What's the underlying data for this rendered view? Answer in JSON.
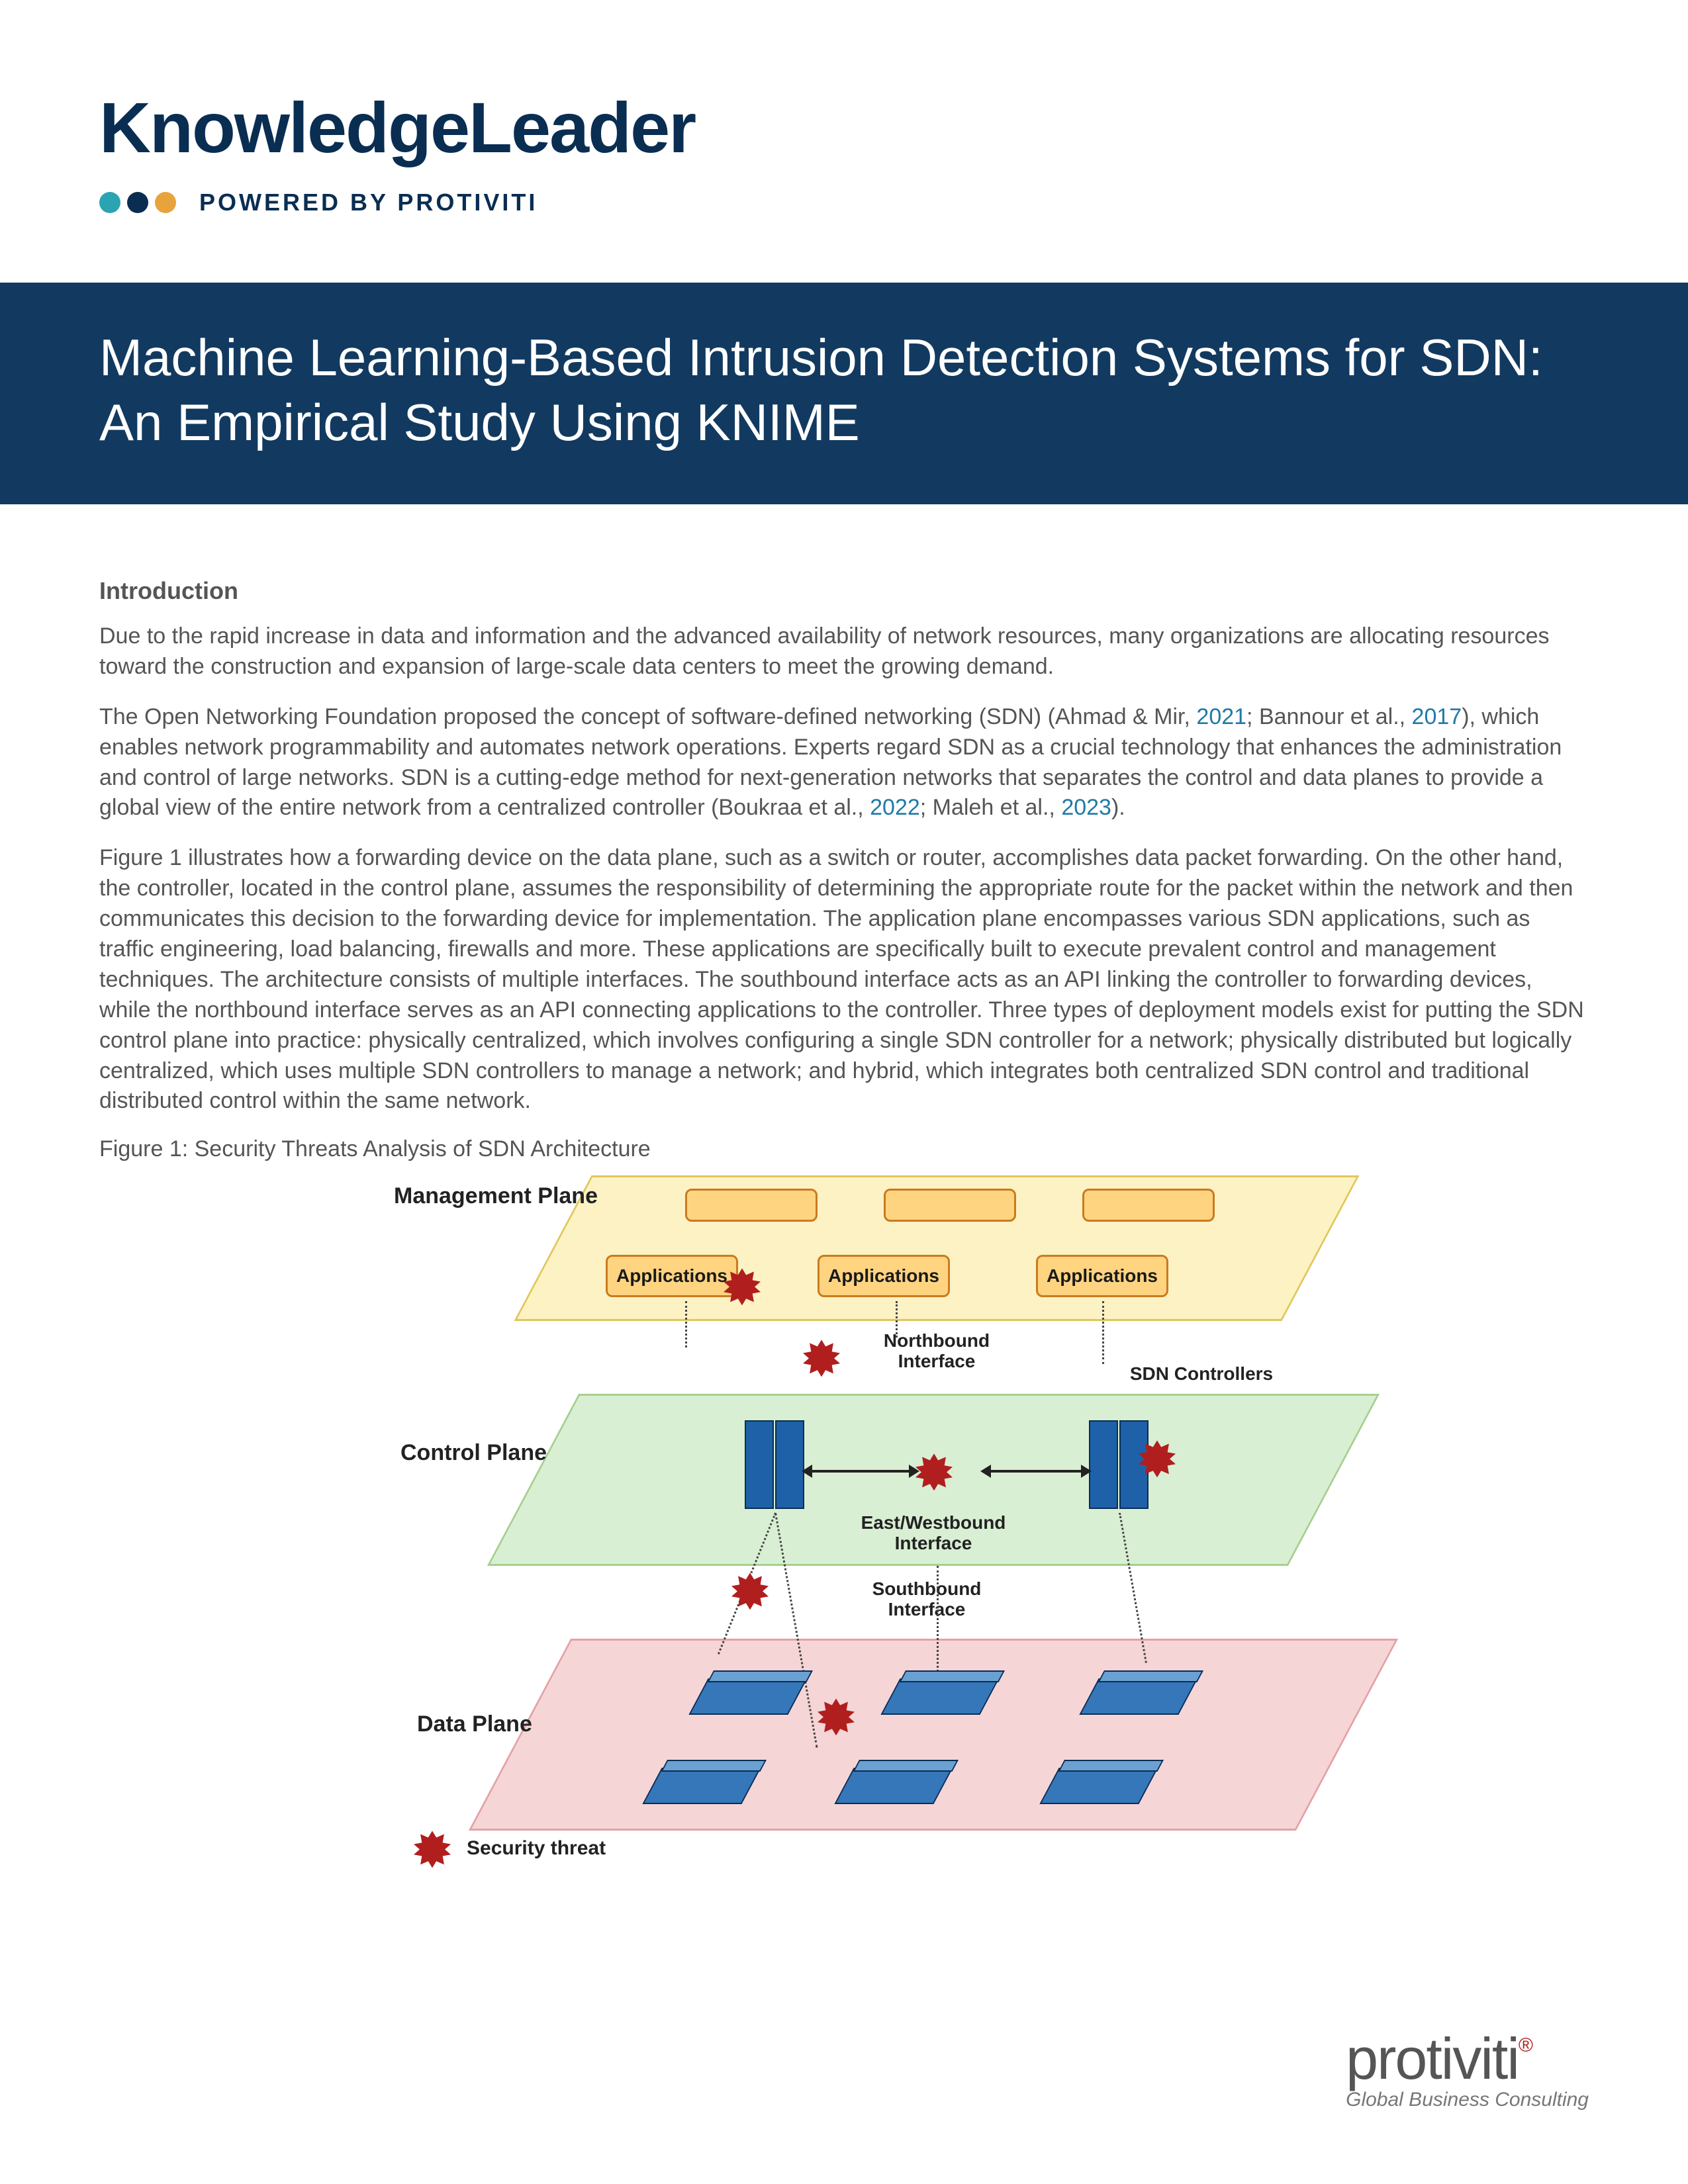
{
  "brand": {
    "name": "KnowledgeLeader",
    "powered": "POWERED BY PROTIVITI"
  },
  "title": "Machine Learning-Based Intrusion Detection Systems for SDN: An Empirical Study Using KNIME",
  "section": {
    "heading": "Introduction",
    "p1": "Due to the rapid increase in data and information and the advanced availability of network resources, many organizations are allocating resources toward the construction and expansion of large-scale data centers to meet the growing demand.",
    "p2a": "The Open Networking Foundation proposed the concept of software-defined networking (SDN) (Ahmad & Mir, ",
    "p2_ref1": "2021",
    "p2b": "; Bannour et al., ",
    "p2_ref2": "2017",
    "p2c": "), which enables network programmability and automates network operations. Experts regard SDN as a crucial technology that enhances the administration and control of large networks. SDN is a cutting-edge method for next-generation networks that separates the control and data planes to provide a global view of the entire network from a centralized controller (Boukraa et al., ",
    "p2_ref3": "2022",
    "p2d": "; Maleh et al., ",
    "p2_ref4": "2023",
    "p2e": ").",
    "p3": "Figure 1 illustrates how a forwarding device on the data plane, such as a switch or router, accomplishes data packet forwarding. On the other hand, the controller, located in the control plane, assumes the responsibility of determining the appropriate route for the packet within the network and then communicates this decision to the forwarding device for implementation. The application plane encompasses various SDN applications, such as traffic engineering, load balancing, firewalls and more. These applications are specifically built to execute prevalent control and management techniques. The architecture consists of multiple interfaces. The southbound interface acts as an API linking the controller to forwarding devices, while the northbound interface serves as an API connecting applications to the controller. Three types of deployment models exist for putting the SDN control plane into practice: physically centralized, which involves configuring a single SDN controller for a network; physically distributed but logically centralized, which uses multiple SDN controllers to manage a network; and hybrid, which integrates both centralized SDN control and traditional distributed control within the same network.",
    "figure_caption": "Figure 1: Security Threats Analysis of SDN Architecture"
  },
  "figure": {
    "planes": {
      "management": "Management Plane",
      "control": "Control Plane",
      "data": "Data Plane"
    },
    "app_label": "Applications",
    "interfaces": {
      "north": "Northbound Interface",
      "east": "East/Westbound Interface",
      "south": "Southbound Interface",
      "sdn": "SDN Controllers"
    },
    "threat_legend": "Security threat"
  },
  "footer": {
    "brand": "protiviti",
    "tagline": "Global Business Consulting"
  }
}
